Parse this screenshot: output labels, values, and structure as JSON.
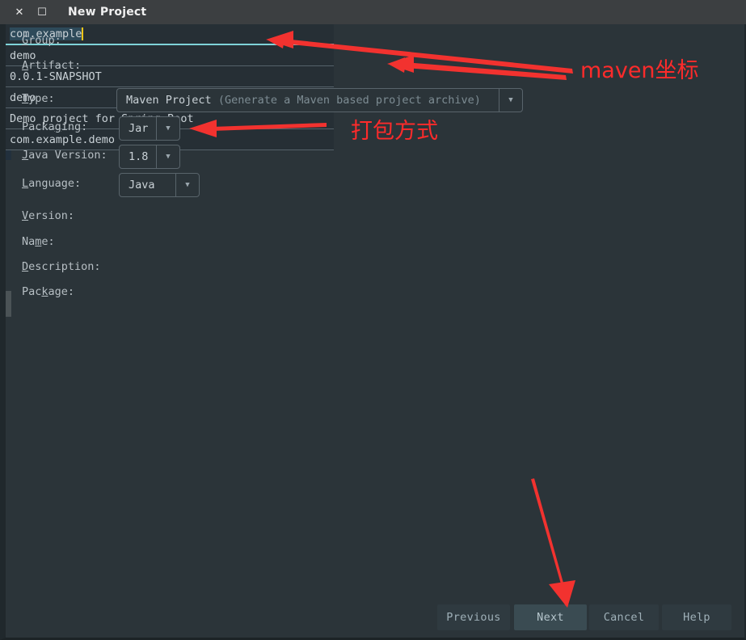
{
  "window": {
    "title": "New Project",
    "close_icon": "close-icon",
    "maximize_icon": "maximize-icon"
  },
  "form": {
    "fields": [
      {
        "label": "Group:",
        "mnemonic": "G",
        "value": "com.example",
        "kind": "text",
        "focused": true
      },
      {
        "label": "Artifact:",
        "mnemonic": "A",
        "value": "demo",
        "kind": "text",
        "focused": false
      },
      {
        "label": "Type:",
        "mnemonic": "T",
        "value": "Maven Project",
        "hint": "(Generate a Maven based project archive)",
        "kind": "combo"
      },
      {
        "label": "Packaging:",
        "mnemonic": "g",
        "value": "Jar",
        "kind": "combo"
      },
      {
        "label": "Java Version:",
        "mnemonic": "J",
        "value": "1.8",
        "kind": "combo"
      },
      {
        "label": "Language:",
        "mnemonic": "L",
        "value": "Java",
        "kind": "combo"
      },
      {
        "label": "Version:",
        "mnemonic": "V",
        "value": "0.0.1-SNAPSHOT",
        "kind": "text",
        "focused": false
      },
      {
        "label": "Name:",
        "mnemonic": "m",
        "value": "demo",
        "kind": "text",
        "focused": false
      },
      {
        "label": "Description:",
        "mnemonic": "D",
        "value": "Demo project for Spring Boot",
        "kind": "text",
        "focused": false
      },
      {
        "label": "Package:",
        "mnemonic": "k",
        "value": "com.example.demo",
        "kind": "text",
        "focused": false
      }
    ],
    "dropdown_arrow_glyph": "▼"
  },
  "buttons": {
    "previous": "Previous",
    "next": "Next",
    "cancel": "Cancel",
    "help": "Help"
  },
  "annotations": {
    "color": "#fd2b2b",
    "maven_coordinates": "maven坐标",
    "packaging_method": "打包方式"
  },
  "colors": {
    "window_bg": "#2b3439",
    "titlebar_bg": "#3c3f41",
    "field_bg": "#262f35",
    "focus_underline": "#7fd3d8",
    "caret": "#f5c518",
    "selection": "#2e4a5a",
    "annotation_red": "#fd2b2b",
    "button_bg": "#2f3a40",
    "button_primary_bg": "#3a4b52"
  }
}
